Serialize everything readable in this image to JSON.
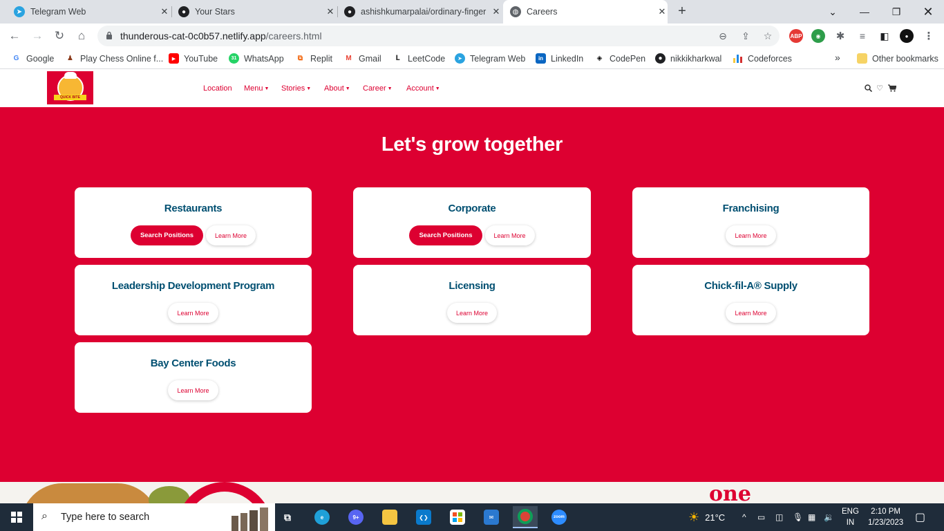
{
  "browser": {
    "tabs": [
      {
        "label": "Telegram Web",
        "icon": "telegram-icon",
        "color": "#2aa3e0"
      },
      {
        "label": "Your Stars",
        "icon": "github-icon",
        "color": "#202124"
      },
      {
        "label": "ashishkumarpalai/ordinary-finger",
        "icon": "github-icon",
        "color": "#202124"
      },
      {
        "label": "Careers",
        "icon": "globe-icon",
        "color": "#5f6368"
      }
    ],
    "url_host": "thunderous-cat-0c0b57.netlify.app",
    "url_path": "/careers.html",
    "bookmarks": [
      {
        "label": "Google",
        "icon": "google-icon"
      },
      {
        "label": "Play Chess Online f...",
        "icon": "chess-icon"
      },
      {
        "label": "YouTube",
        "icon": "youtube-icon"
      },
      {
        "label": "WhatsApp",
        "icon": "whatsapp-icon"
      },
      {
        "label": "Replit",
        "icon": "replit-icon"
      },
      {
        "label": "Gmail",
        "icon": "gmail-icon"
      },
      {
        "label": "LeetCode",
        "icon": "leetcode-icon"
      },
      {
        "label": "Telegram Web",
        "icon": "telegram-icon"
      },
      {
        "label": "LinkedIn",
        "icon": "linkedin-icon"
      },
      {
        "label": "CodePen",
        "icon": "codepen-icon"
      },
      {
        "label": "nikkikharkwal",
        "icon": "github-icon"
      },
      {
        "label": "Codeforces",
        "icon": "codeforces-icon"
      }
    ],
    "other_bookmarks": "Other bookmarks",
    "overflow": "»",
    "ext_abp": "ABP"
  },
  "site": {
    "logo_text": "QUICK BITE",
    "nav": [
      {
        "label": "Location",
        "dropdown": false
      },
      {
        "label": "Menu",
        "dropdown": true
      },
      {
        "label": "Stories",
        "dropdown": true
      },
      {
        "label": "About",
        "dropdown": true
      },
      {
        "label": "Career",
        "dropdown": true
      },
      {
        "label": "Account",
        "dropdown": true
      }
    ],
    "brand_color": "#dd0031",
    "title_color": "#004f71"
  },
  "hero": {
    "title": "Let's grow together",
    "cards": [
      {
        "title": "Restaurants",
        "primary": "Search Positions",
        "secondary": "Learn More"
      },
      {
        "title": "Corporate",
        "primary": "Search Positions",
        "secondary": "Learn More"
      },
      {
        "title": "Franchising",
        "primary": null,
        "secondary": "Learn More"
      },
      {
        "title": "Leadership Development Program",
        "primary": null,
        "secondary": "Learn More"
      },
      {
        "title": "Licensing",
        "primary": null,
        "secondary": "Learn More"
      },
      {
        "title": "Chick-fil-A® Supply",
        "primary": null,
        "secondary": "Learn More"
      },
      {
        "title": "Bay Center Foods",
        "primary": null,
        "secondary": "Learn More"
      }
    ]
  },
  "footer_peek": {
    "text": "one"
  },
  "taskbar": {
    "search_placeholder": "Type here to search",
    "weather": "21°C",
    "lang_top": "ENG",
    "lang_bottom": "IN",
    "time": "2:10 PM",
    "date": "1/23/2023",
    "discord_badge": "9+",
    "zoom_label": "zoom"
  }
}
